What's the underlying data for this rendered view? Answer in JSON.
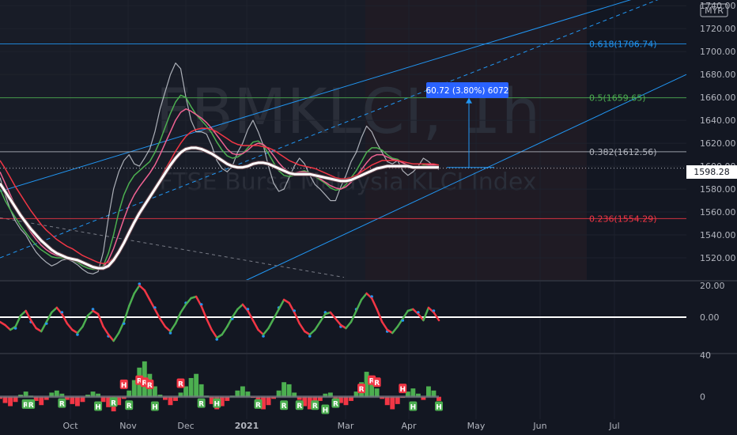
{
  "chart_data": [
    {
      "type": "line",
      "role": "main-price-panel",
      "symbol": "FBMKLCI, 1h",
      "description": "FTSE Bursa Malaysia KLCI Index",
      "currency": "MYR",
      "last_price": "1598.28",
      "ylim": [
        1500,
        1745
      ],
      "y_ticks": [
        "1740.00",
        "1720.00",
        "1700.00",
        "1680.00",
        "1660.00",
        "1640.00",
        "1620.00",
        "1600.00",
        "1580.00",
        "1560.00",
        "1540.00",
        "1520.00"
      ],
      "x_labels": [
        "Oct",
        "Nov",
        "Dec",
        "2021",
        "Mar",
        "Apr",
        "May",
        "Jun",
        "Jul"
      ],
      "fib_levels": [
        {
          "label": "0.618(1706.74)",
          "value": 1706.74,
          "color": "#2196f3"
        },
        {
          "label": "0.5(1659.65)",
          "value": 1659.65,
          "color": "#4caf50"
        },
        {
          "label": "0.382(1612.56)",
          "value": 1612.56,
          "color": "#b2b5be"
        },
        {
          "label": "0.236(1554.29)",
          "value": 1554.29,
          "color": "#f23645"
        }
      ],
      "measure_label": "60.72 (3.80%) 6072",
      "series": [
        {
          "color": "#d1d4dc",
          "values": [
            1590,
            1575,
            1562,
            1552,
            1545,
            1540,
            1532,
            1525,
            1520,
            1516,
            1513,
            1515,
            1518,
            1519,
            1517,
            1514,
            1510,
            1507,
            1506,
            1508,
            1525,
            1555,
            1580,
            1595,
            1605,
            1610,
            1602,
            1600,
            1607,
            1615,
            1630,
            1650,
            1665,
            1680,
            1690,
            1685,
            1660,
            1640,
            1630,
            1630,
            1628,
            1618,
            1605,
            1598,
            1595,
            1600,
            1612,
            1620,
            1632,
            1640,
            1630,
            1618,
            1600,
            1585,
            1578,
            1580,
            1590,
            1600,
            1607,
            1602,
            1592,
            1584,
            1580,
            1575,
            1570,
            1570,
            1582,
            1592,
            1604,
            1612,
            1625,
            1635,
            1630,
            1620,
            1612,
            1604,
            1602,
            1605,
            1596,
            1592,
            1595,
            1600,
            1607,
            1604,
            1600,
            1597
          ]
        },
        {
          "color": "#4caf50",
          "values": [
            1580,
            1570,
            1562,
            1555,
            1548,
            1542,
            1536,
            1531,
            1527,
            1524,
            1521,
            1520,
            1520,
            1519,
            1518,
            1516,
            1513,
            1511,
            1510,
            1510,
            1513,
            1524,
            1540,
            1560,
            1575,
            1585,
            1592,
            1596,
            1600,
            1604,
            1612,
            1622,
            1634,
            1646,
            1656,
            1662,
            1660,
            1652,
            1645,
            1640,
            1635,
            1629,
            1621,
            1614,
            1609,
            1607,
            1608,
            1611,
            1616,
            1621,
            1622,
            1618,
            1611,
            1603,
            1596,
            1592,
            1591,
            1592,
            1595,
            1596,
            1594,
            1591,
            1588,
            1585,
            1581,
            1579,
            1580,
            1584,
            1590,
            1596,
            1604,
            1612,
            1616,
            1616,
            1614,
            1610,
            1607,
            1606,
            1603,
            1600,
            1599,
            1599,
            1601,
            1602,
            1601,
            1600
          ]
        },
        {
          "color": "#f06292",
          "values": [
            1595,
            1585,
            1575,
            1565,
            1556,
            1549,
            1542,
            1536,
            1531,
            1527,
            1524,
            1522,
            1521,
            1520,
            1519,
            1517,
            1515,
            1513,
            1512,
            1511,
            1512,
            1518,
            1528,
            1541,
            1554,
            1566,
            1575,
            1582,
            1588,
            1594,
            1601,
            1610,
            1620,
            1630,
            1640,
            1647,
            1650,
            1648,
            1645,
            1642,
            1638,
            1633,
            1627,
            1621,
            1615,
            1611,
            1610,
            1611,
            1614,
            1618,
            1620,
            1619,
            1615,
            1609,
            1603,
            1598,
            1595,
            1594,
            1595,
            1595,
            1594,
            1592,
            1589,
            1586,
            1583,
            1581,
            1580,
            1582,
            1586,
            1591,
            1597,
            1603,
            1608,
            1610,
            1610,
            1608,
            1606,
            1605,
            1603,
            1601,
            1600,
            1600,
            1600,
            1601,
            1601,
            1600
          ]
        },
        {
          "color": "#f23645",
          "values": [
            1605,
            1598,
            1590,
            1582,
            1575,
            1568,
            1561,
            1555,
            1549,
            1544,
            1540,
            1536,
            1533,
            1530,
            1528,
            1525,
            1522,
            1520,
            1518,
            1516,
            1515,
            1516,
            1520,
            1527,
            1535,
            1544,
            1552,
            1560,
            1567,
            1574,
            1581,
            1589,
            1597,
            1605,
            1613,
            1620,
            1626,
            1630,
            1632,
            1633,
            1633,
            1632,
            1630,
            1627,
            1624,
            1621,
            1619,
            1618,
            1618,
            1618,
            1618,
            1617,
            1616,
            1614,
            1611,
            1608,
            1605,
            1603,
            1601,
            1600,
            1599,
            1598,
            1596,
            1594,
            1592,
            1590,
            1589,
            1589,
            1590,
            1592,
            1595,
            1598,
            1601,
            1603,
            1605,
            1605,
            1605,
            1605,
            1604,
            1603,
            1602,
            1602,
            1602,
            1602,
            1602,
            1601
          ]
        },
        {
          "color": "#ffffff",
          "values": [
            1585,
            1578,
            1571,
            1564,
            1557,
            1551,
            1545,
            1540,
            1535,
            1531,
            1527,
            1524,
            1522,
            1520,
            1519,
            1518,
            1516,
            1514,
            1512,
            1511,
            1511,
            1513,
            1518,
            1525,
            1533,
            1542,
            1551,
            1559,
            1566,
            1573,
            1580,
            1587,
            1594,
            1601,
            1607,
            1612,
            1615,
            1616,
            1616,
            1615,
            1613,
            1611,
            1608,
            1605,
            1602,
            1600,
            1599,
            1599,
            1600,
            1602,
            1603,
            1603,
            1602,
            1600,
            1598,
            1596,
            1594,
            1593,
            1593,
            1593,
            1593,
            1592,
            1591,
            1590,
            1589,
            1588,
            1587,
            1587,
            1588,
            1590,
            1592,
            1594,
            1596,
            1598,
            1599,
            1600,
            1600,
            1600,
            1600,
            1600,
            1599,
            1599,
            1599,
            1599,
            1599,
            1599
          ]
        }
      ]
    },
    {
      "type": "line",
      "role": "oscillator-panel",
      "ylim": [
        -22,
        22
      ],
      "y_ticks": [
        "20.00",
        "0.00"
      ],
      "zero_label": "0.00",
      "series": [
        {
          "color": "#ffffff",
          "values": [
            -3,
            -5,
            -8,
            -6,
            1,
            4,
            -2,
            -7,
            -9,
            -3,
            3,
            6,
            2,
            -4,
            -8,
            -10,
            -6,
            1,
            4,
            2,
            -6,
            -11,
            -15,
            -10,
            -3,
            7,
            15,
            20,
            17,
            11,
            5,
            -1,
            -6,
            -9,
            -4,
            3,
            8,
            12,
            13,
            7,
            -1,
            -8,
            -13,
            -11,
            -6,
            0,
            5,
            8,
            4,
            -2,
            -8,
            -11,
            -7,
            -1,
            5,
            11,
            9,
            3,
            -4,
            -9,
            -11,
            -8,
            -3,
            2,
            3,
            -1,
            -5,
            -7,
            -3,
            4,
            11,
            15,
            12,
            5,
            -3,
            -8,
            -10,
            -6,
            -1,
            4,
            5,
            2,
            -2,
            6,
            3,
            -2
          ]
        }
      ]
    },
    {
      "type": "bar",
      "role": "histogram-panel",
      "ylim": [
        -20,
        40
      ],
      "y_ticks": [
        "40",
        "0"
      ],
      "values": [
        -2,
        -6,
        -9,
        -5,
        2,
        5,
        1,
        -4,
        -8,
        -3,
        4,
        6,
        3,
        -3,
        -7,
        -9,
        -5,
        2,
        5,
        3,
        -5,
        -10,
        -14,
        -8,
        -2,
        6,
        16,
        28,
        34,
        22,
        10,
        2,
        -3,
        -8,
        -4,
        4,
        10,
        18,
        22,
        12,
        1,
        -7,
        -12,
        -9,
        -4,
        1,
        6,
        10,
        5,
        -1,
        -8,
        -12,
        -8,
        -2,
        6,
        14,
        12,
        4,
        -3,
        -9,
        -12,
        -9,
        -4,
        3,
        4,
        -2,
        -6,
        -8,
        -4,
        5,
        14,
        24,
        20,
        8,
        -2,
        -8,
        -12,
        -7,
        -1,
        5,
        8,
        3,
        -3,
        10,
        6,
        -4
      ],
      "markers": [
        {
          "label": "H",
          "index": 24,
          "value": 12,
          "color": "#f23645"
        },
        {
          "label": "R",
          "index": 27,
          "value": 16,
          "color": "#f23645"
        },
        {
          "label": "R",
          "index": 28,
          "value": 14,
          "color": "#f23645"
        },
        {
          "label": "R",
          "index": 29,
          "value": 12,
          "color": "#f23645"
        },
        {
          "label": "R",
          "index": 35,
          "value": 13,
          "color": "#f23645"
        },
        {
          "label": "R",
          "index": 70,
          "value": 8,
          "color": "#f23645"
        },
        {
          "label": "R",
          "index": 72,
          "value": 16,
          "color": "#f23645"
        },
        {
          "label": "R",
          "index": 73,
          "value": 14,
          "color": "#f23645"
        },
        {
          "label": "H",
          "index": 78,
          "value": 8,
          "color": "#f23645"
        },
        {
          "label": "R",
          "index": 5,
          "value": -7,
          "color": "#4caf50"
        },
        {
          "label": "R",
          "index": 6,
          "value": -7,
          "color": "#4caf50"
        },
        {
          "label": "R",
          "index": 12,
          "value": -6,
          "color": "#4caf50"
        },
        {
          "label": "H",
          "index": 19,
          "value": -9,
          "color": "#4caf50"
        },
        {
          "label": "R",
          "index": 22,
          "value": -5,
          "color": "#4caf50"
        },
        {
          "label": "R",
          "index": 25,
          "value": -8,
          "color": "#4caf50"
        },
        {
          "label": "H",
          "index": 30,
          "value": -9,
          "color": "#4caf50"
        },
        {
          "label": "R",
          "index": 39,
          "value": -6,
          "color": "#4caf50"
        },
        {
          "label": "H",
          "index": 42,
          "value": -6,
          "color": "#4caf50"
        },
        {
          "label": "R",
          "index": 50,
          "value": -7,
          "color": "#4caf50"
        },
        {
          "label": "R",
          "index": 55,
          "value": -8,
          "color": "#4caf50"
        },
        {
          "label": "R",
          "index": 58,
          "value": -8,
          "color": "#4caf50"
        },
        {
          "label": "R",
          "index": 61,
          "value": -8,
          "color": "#4caf50"
        },
        {
          "label": "H",
          "index": 63,
          "value": -12,
          "color": "#4caf50"
        },
        {
          "label": "R",
          "index": 65,
          "value": -6,
          "color": "#4caf50"
        },
        {
          "label": "H",
          "index": 80,
          "value": -9,
          "color": "#4caf50"
        },
        {
          "label": "H",
          "index": 85,
          "value": -9,
          "color": "#4caf50"
        }
      ]
    }
  ]
}
